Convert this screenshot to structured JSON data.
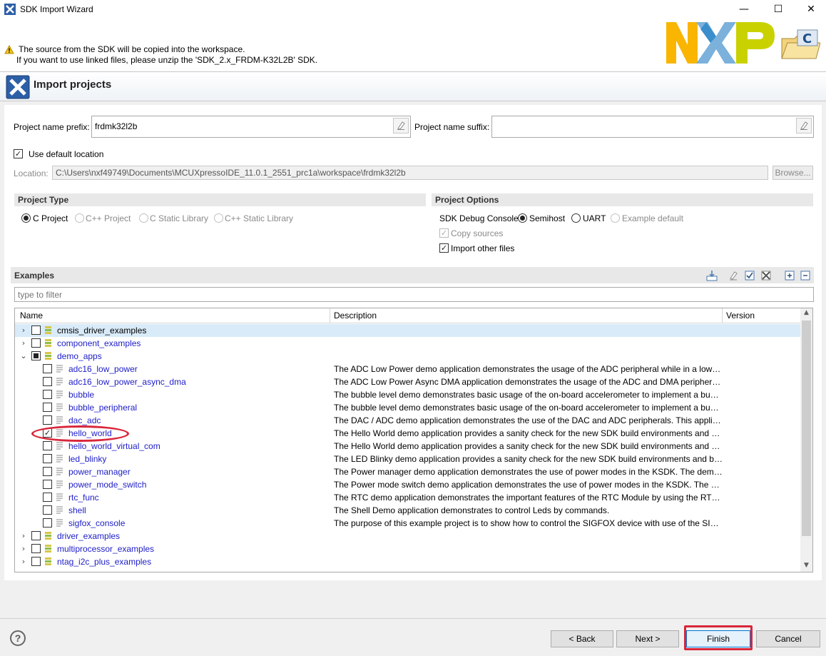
{
  "window": {
    "title": "SDK Import Wizard",
    "minimize_glyph": "—",
    "maximize_glyph": "☐",
    "close_glyph": "✕"
  },
  "banner": {
    "line1": "The source from the SDK will be copied into the workspace.",
    "line2": "If you want to use linked files, please unzip the 'SDK_2.x_FRDM-K32L2B' SDK.",
    "logo_text": "NXP"
  },
  "header": {
    "title": "Import projects"
  },
  "form": {
    "prefix_label": "Project name prefix:",
    "prefix_value": "frdmk32l2b",
    "suffix_label": "Project name suffix:",
    "suffix_value": "",
    "use_default_location_label": "Use default location",
    "location_label": "Location:",
    "location_value": "C:\\Users\\nxf49749\\Documents\\MCUXpressoIDE_11.0.1_2551_prc1a\\workspace\\frdmk32l2b",
    "browse_label": "Browse..."
  },
  "project_type": {
    "title": "Project Type",
    "options": [
      "C Project",
      "C++ Project",
      "C Static Library",
      "C++ Static Library"
    ]
  },
  "project_options": {
    "title": "Project Options",
    "debug_console_label": "SDK Debug Console",
    "console_options": [
      "Semihost",
      "UART",
      "Example default"
    ],
    "copy_sources_label": "Copy sources",
    "import_other_files_label": "Import other files"
  },
  "examples": {
    "title": "Examples",
    "filter_placeholder": "type to filter",
    "columns": [
      "Name",
      "Description",
      "Version"
    ],
    "rows": [
      {
        "name": "cmsis_driver_examples",
        "desc": ""
      },
      {
        "name": "component_examples",
        "desc": ""
      },
      {
        "name": "demo_apps",
        "desc": ""
      },
      {
        "name": "adc16_low_power",
        "desc": "The ADC Low Power demo application demonstrates the usage of the ADC peripheral while in a low power mode."
      },
      {
        "name": "adc16_low_power_async_dma",
        "desc": "The ADC Low Power Async DMA application demonstrates the usage of the ADC and DMA peripherals."
      },
      {
        "name": "bubble",
        "desc": "The bubble level demo demonstrates basic usage of the on-board accelerometer to implement a bubble level."
      },
      {
        "name": "bubble_peripheral",
        "desc": "The bubble level demo demonstrates basic usage of the on-board accelerometer to implement a bubble level."
      },
      {
        "name": "dac_adc",
        "desc": "The DAC / ADC demo application demonstrates the use of the DAC and ADC peripherals. This application demonstrates"
      },
      {
        "name": "hello_world",
        "desc": "The Hello World demo application provides a sanity check for the new SDK build environments and board bring up."
      },
      {
        "name": "hello_world_virtual_com",
        "desc": "The Hello World demo application provides a sanity check for the new SDK build environments and board bring up."
      },
      {
        "name": "led_blinky",
        "desc": "The LED Blinky demo application provides a sanity check for the new SDK build environments and board bring up."
      },
      {
        "name": "power_manager",
        "desc": "The Power manager demo application demonstrates the use of power modes in the KSDK. The demo uses"
      },
      {
        "name": "power_mode_switch",
        "desc": "The Power mode switch demo application demonstrates the use of power modes in the KSDK. The demo uses"
      },
      {
        "name": "rtc_func",
        "desc": "The RTC demo application demonstrates the important features of the RTC Module by using the RTC Peripheral Driver."
      },
      {
        "name": "shell",
        "desc": "The Shell Demo application demonstrates to control Leds by commands."
      },
      {
        "name": "sigfox_console",
        "desc": "The purpose of this example project is to show how to control the SIGFOX device with use of the SIGFOX driver."
      },
      {
        "name": "driver_examples",
        "desc": ""
      },
      {
        "name": "multiprocessor_examples",
        "desc": ""
      },
      {
        "name": "ntag_i2c_plus_examples",
        "desc": ""
      }
    ]
  },
  "buttons": {
    "back": "< Back",
    "next": "Next >",
    "finish": "Finish",
    "cancel": "Cancel",
    "help": "?"
  },
  "colors": {
    "highlight": "#d9263a",
    "link_blue": "#2020c8",
    "selected_row": "#d9ebf9",
    "nxp_yellow": "#f9b500",
    "nxp_blue": "#7bb1db",
    "nxp_green": "#c9d200"
  }
}
